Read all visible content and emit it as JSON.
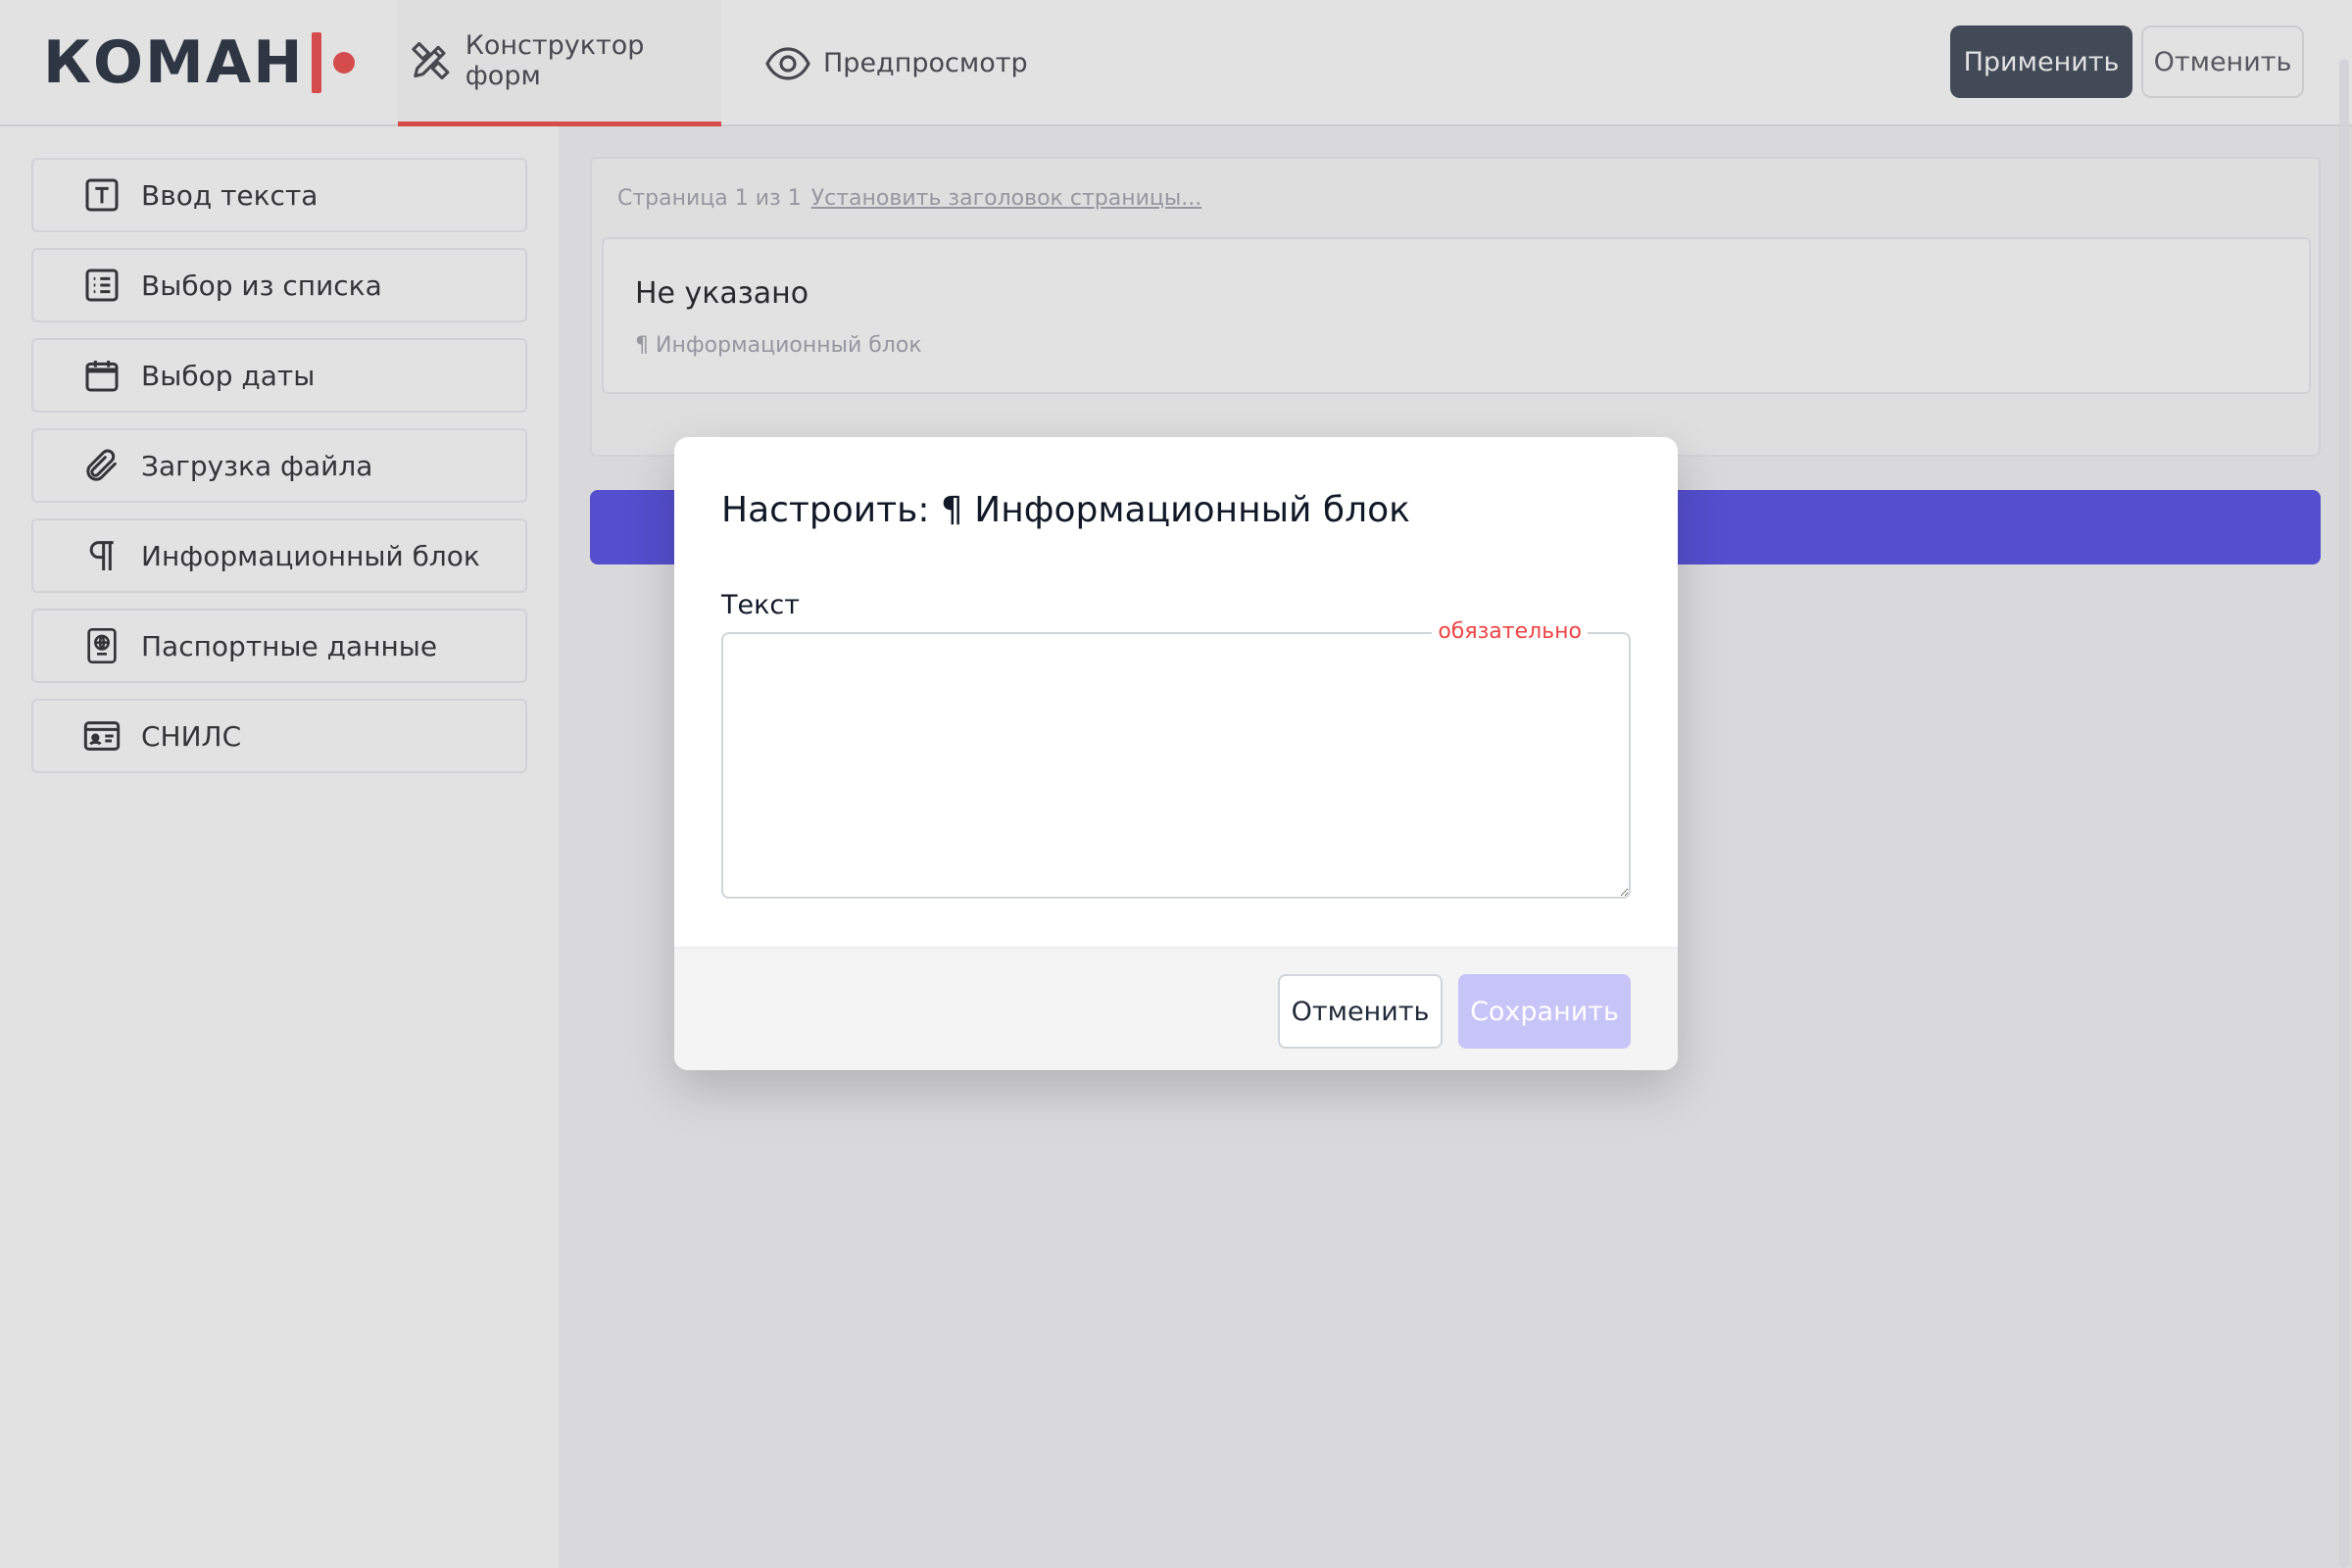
{
  "header": {
    "logo_text": "КОМАН",
    "tabs": [
      {
        "label": "Конструктор форм",
        "icon": "pencil-ruler-icon",
        "active": true
      },
      {
        "label": "Предпросмотр",
        "icon": "eye-icon",
        "active": false
      }
    ],
    "apply_label": "Применить",
    "cancel_label": "Отменить"
  },
  "sidebar": {
    "items": [
      {
        "label": "Ввод текста",
        "icon": "text-input-icon"
      },
      {
        "label": "Выбор из списка",
        "icon": "list-select-icon"
      },
      {
        "label": "Выбор даты",
        "icon": "calendar-icon"
      },
      {
        "label": "Загрузка файла",
        "icon": "paperclip-icon"
      },
      {
        "label": "Информационный блок",
        "icon": "pilcrow-icon"
      },
      {
        "label": "Паспортные данные",
        "icon": "passport-icon"
      },
      {
        "label": "СНИЛС",
        "icon": "id-card-icon"
      }
    ]
  },
  "main": {
    "page_counter": "Страница 1 из 1",
    "set_title_link": "Установить заголовок страницы...",
    "field": {
      "title": "Не указано",
      "type_label": "¶ Информационный блок"
    }
  },
  "modal": {
    "title": "Настроить: ¶ Информационный блок",
    "field_label": "Текст",
    "required_label": "обязательно",
    "text_value": "",
    "cancel_label": "Отменить",
    "save_label": "Сохранить"
  },
  "colors": {
    "accent": "#4f46e5",
    "brand_red": "#ef4444",
    "apply_button": "#374151",
    "save_disabled": "#c7c4f7"
  }
}
